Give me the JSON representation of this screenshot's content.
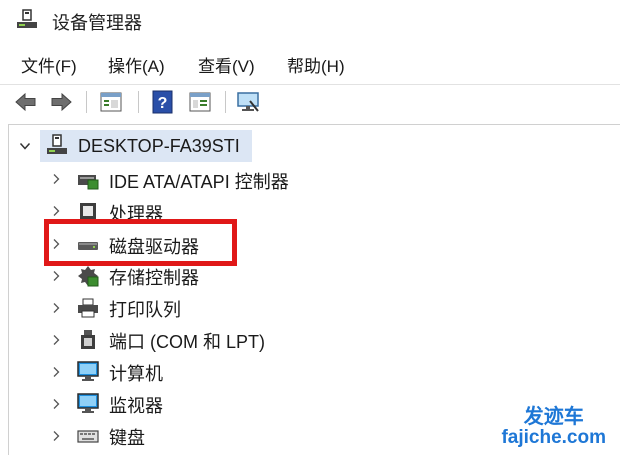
{
  "window": {
    "title": "设备管理器"
  },
  "menu": {
    "file": "文件(F)",
    "action": "操作(A)",
    "view": "查看(V)",
    "help": "帮助(H)"
  },
  "toolbar": {
    "icons": [
      "back-arrow-icon",
      "forward-arrow-icon",
      "properties-icon",
      "help-icon",
      "view-details-icon",
      "monitor-scan-icon"
    ]
  },
  "tree": {
    "root": {
      "label": "DESKTOP-FA39STI",
      "expanded": true
    },
    "children": [
      {
        "label": "IDE ATA/ATAPI 控制器",
        "icon": "ide-controller-icon"
      },
      {
        "label": "处理器",
        "icon": "processor-icon"
      },
      {
        "label": "磁盘驱动器",
        "icon": "disk-drive-icon",
        "highlighted": true
      },
      {
        "label": "存储控制器",
        "icon": "storage-controller-icon"
      },
      {
        "label": "打印队列",
        "icon": "printer-icon"
      },
      {
        "label": "端口 (COM 和 LPT)",
        "icon": "port-icon"
      },
      {
        "label": "计算机",
        "icon": "computer-icon"
      },
      {
        "label": "监视器",
        "icon": "monitor-icon"
      },
      {
        "label": "键盘",
        "icon": "keyboard-icon"
      }
    ]
  },
  "watermark": {
    "line1": "发迹车",
    "line2": "fajiche.com"
  },
  "colors": {
    "selection": "#dce6f4",
    "highlight_box": "#e01818",
    "watermark": "#1e77d6"
  }
}
